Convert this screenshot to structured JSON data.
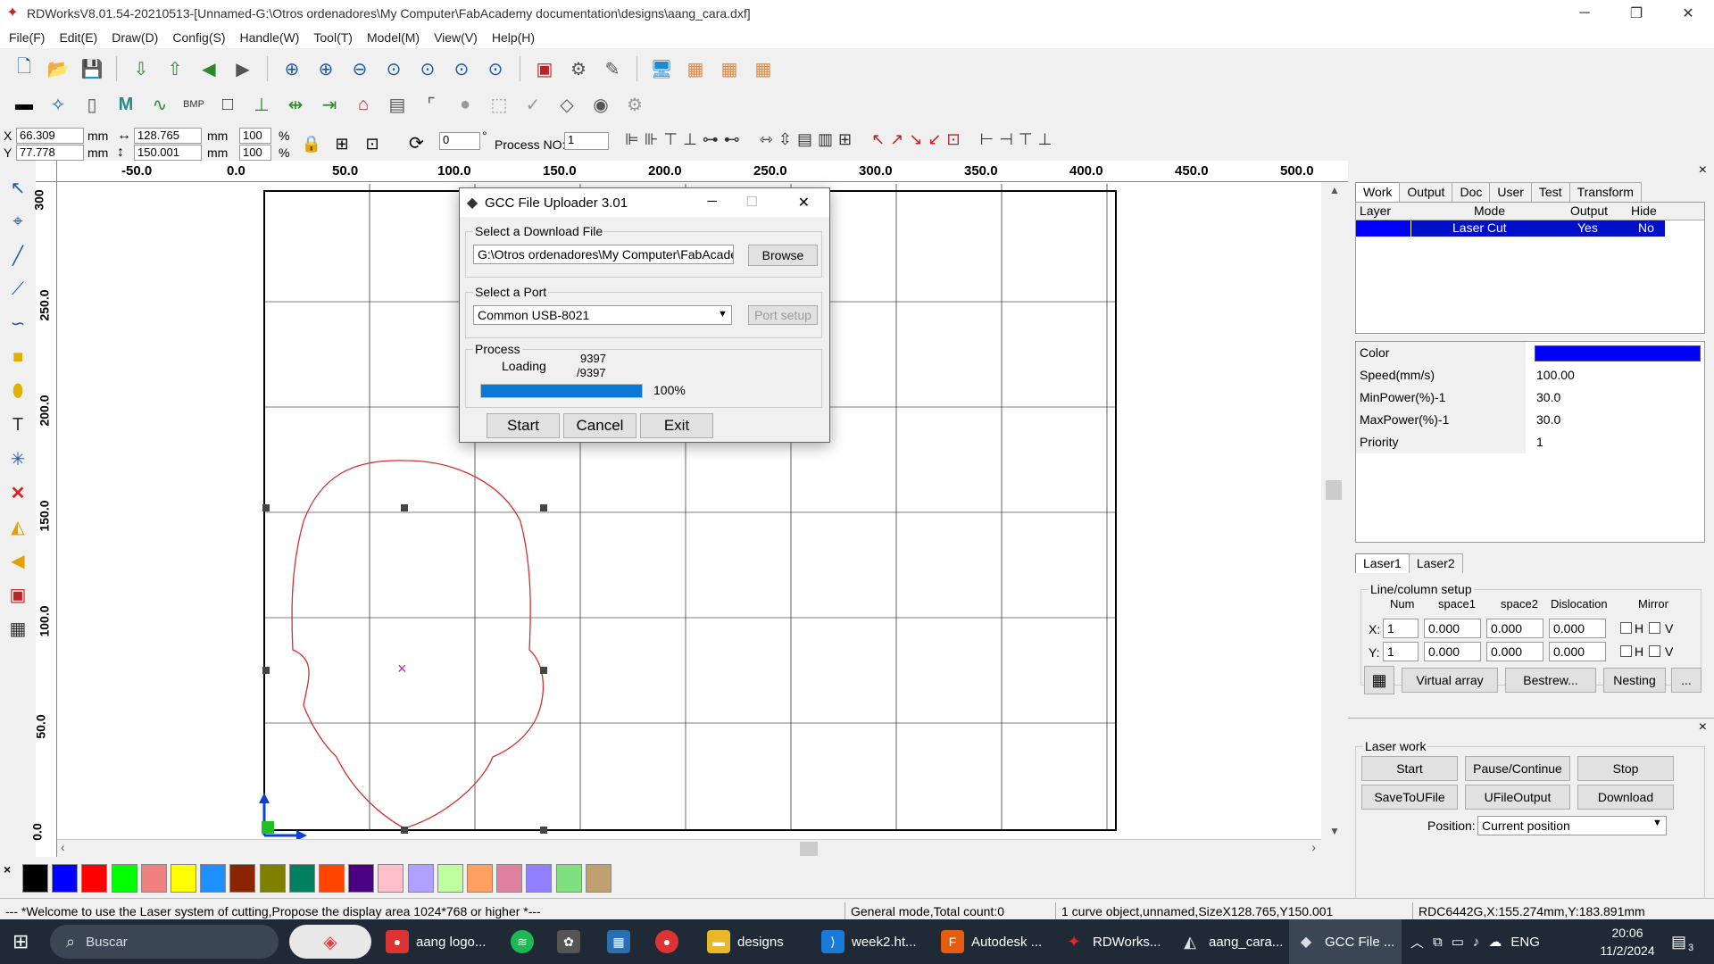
{
  "window": {
    "title": "RDWorksV8.01.54-20210513-[Unnamed-G:\\Otros ordenadores\\My Computer\\FabAcademy documentation\\designs\\aang_cara.dxf]",
    "controls": [
      "─",
      "❐",
      "✕"
    ]
  },
  "menu": [
    "File(F)",
    "Edit(E)",
    "Draw(D)",
    "Config(S)",
    "Handle(W)",
    "Tool(T)",
    "Model(M)",
    "View(V)",
    "Help(H)"
  ],
  "coords": {
    "x_label": "X",
    "x_value": "66.309",
    "y_label": "Y",
    "y_value": "77.778",
    "unit": "mm",
    "width_value": "128.765",
    "height_value": "150.001",
    "scale_x": "100",
    "scale_y": "100",
    "percent": "%",
    "rotate_value": "0",
    "degree": "°",
    "process_no_label": "Process NO:",
    "process_no_value": "1"
  },
  "ruler": {
    "h_labels": [
      "-50.0",
      "0.0",
      "50.0",
      "100.0",
      "150.0",
      "200.0",
      "250.0",
      "300.0",
      "350.0",
      "400.0",
      "450.0",
      "500.0"
    ],
    "v_labels": [
      "300",
      "250.0",
      "200.0",
      "150.0",
      "100.0",
      "50.0",
      "0.0"
    ]
  },
  "palette": {
    "x_mark": "×",
    "colors": [
      "#000000",
      "#0000ff",
      "#ff0000",
      "#00ff00",
      "#f08080",
      "#ffff00",
      "#1e90ff",
      "#8b2500",
      "#808000",
      "#008060",
      "#ff4500",
      "#4b0082",
      "#ffc0cb",
      "#b0a0ff",
      "#c0ffa0",
      "#ffa060",
      "#e080a0",
      "#9080ff",
      "#80e080",
      "#c0a070"
    ]
  },
  "dialog": {
    "title": "GCC File Uploader 3.01",
    "controls": [
      "─",
      "☐",
      "✕"
    ],
    "download_group": "Select a Download File",
    "file_path": "G:\\Otros ordenadores\\My Computer\\FabAcader",
    "browse": "Browse",
    "port_group": "Select a Port",
    "port_value": "Common USB-8021",
    "port_setup": "Port setup",
    "process_group": "Process",
    "loading": "Loading",
    "count_top": "9397",
    "count_bottom": "/9397",
    "progress": 1.0,
    "progress_text": "100%",
    "start": "Start",
    "cancel": "Cancel",
    "exit": "Exit"
  },
  "right_panel": {
    "close": "×",
    "tabs": [
      "Work",
      "Output",
      "Doc",
      "User",
      "Test",
      "Transform"
    ],
    "layer_headers": [
      "Layer",
      "Mode",
      "Output",
      "Hide"
    ],
    "layer_row": {
      "color": "#0000ff",
      "mode": "Laser Cut",
      "output": "Yes",
      "hide": "No"
    },
    "props": [
      {
        "label": "Color",
        "value": ""
      },
      {
        "label": "Speed(mm/s)",
        "value": "100.00"
      },
      {
        "label": "MinPower(%)-1",
        "value": "30.0"
      },
      {
        "label": "MaxPower(%)-1",
        "value": "30.0"
      },
      {
        "label": "Priority",
        "value": "1"
      }
    ],
    "color_value": "#0000ff",
    "laser_tabs": [
      "Laser1",
      "Laser2"
    ],
    "linecol": {
      "title": "Line/column setup",
      "headers": [
        "Num",
        "space1",
        "space2",
        "Dislocation",
        "Mirror"
      ],
      "x_label": "X:",
      "y_label": "Y:",
      "x_values": [
        "1",
        "0.000",
        "0.000",
        "0.000"
      ],
      "y_values": [
        "1",
        "0.000",
        "0.000",
        "0.000"
      ],
      "h": "H",
      "v": "V"
    },
    "buttons_row": [
      "Virtual array",
      "Bestrew...",
      "Nesting",
      "..."
    ],
    "laser_work": {
      "title": "Laser work",
      "close": "×",
      "start": "Start",
      "pause": "Pause/Continue",
      "stop": "Stop",
      "save": "SaveToUFile",
      "ufile": "UFileOutput",
      "download": "Download",
      "position_label": "Position:",
      "position_value": "Current position"
    }
  },
  "status": {
    "welcome": "--- *Welcome to use the Laser system of cutting,Propose the display area 1024*768 or higher *---",
    "mode": "General mode,Total count:0",
    "object": "1 curve object,unnamed,SizeX128.765,Y150.001",
    "coords": "RDC6442G,X:155.274mm,Y:183.891mm"
  },
  "taskbar": {
    "search": "Buscar",
    "apps": [
      "aang logo...",
      "designs",
      "week2.ht...",
      "Autodesk ...",
      "RDWorks...",
      "aang_cara...",
      "GCC File ..."
    ],
    "lang": "ENG",
    "time": "20:06",
    "date": "11/2/2024",
    "notif": "3"
  }
}
